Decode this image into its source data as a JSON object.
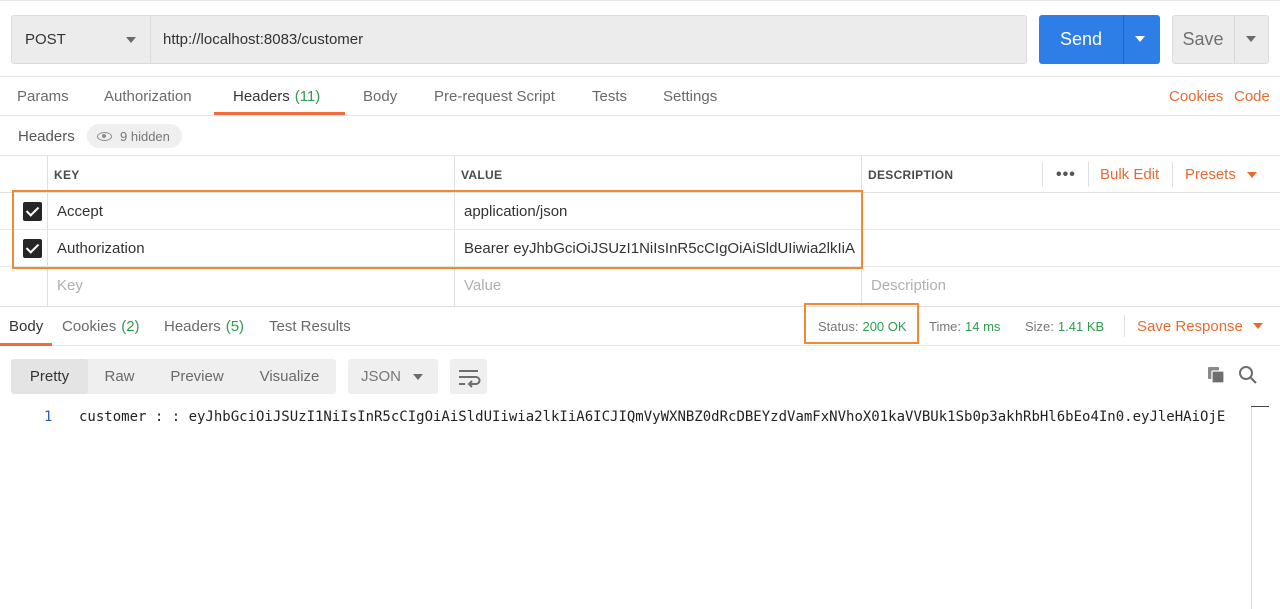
{
  "request": {
    "method": "POST",
    "url": "http://localhost:8083/customer",
    "send_label": "Send",
    "save_label": "Save"
  },
  "request_tabs": [
    {
      "label": "Params"
    },
    {
      "label": "Authorization"
    },
    {
      "label": "Headers",
      "count": "(11)",
      "active": true
    },
    {
      "label": "Body"
    },
    {
      "label": "Pre-request Script"
    },
    {
      "label": "Tests"
    },
    {
      "label": "Settings"
    }
  ],
  "request_links": {
    "cookies": "Cookies",
    "code": "Code"
  },
  "headers_section": {
    "title": "Headers",
    "hidden": "9 hidden"
  },
  "headers_table": {
    "columns": {
      "key": "KEY",
      "value": "VALUE",
      "description": "DESCRIPTION"
    },
    "more": "•••",
    "bulk_edit": "Bulk Edit",
    "presets": "Presets",
    "rows": [
      {
        "checked": true,
        "key": "Accept",
        "value": "application/json",
        "description": ""
      },
      {
        "checked": true,
        "key": "Authorization",
        "value": "Bearer eyJhbGciOiJSUzI1NiIsInR5cCIgOiAiSldUIiwia2lkIiA ...",
        "description": ""
      }
    ],
    "new_row": {
      "key_placeholder": "Key",
      "value_placeholder": "Value",
      "description_placeholder": "Description"
    }
  },
  "response": {
    "tabs": [
      {
        "label": "Body",
        "active": true
      },
      {
        "label": "Cookies",
        "count": "(2)"
      },
      {
        "label": "Headers",
        "count": "(5)"
      },
      {
        "label": "Test Results"
      }
    ],
    "status_label": "Status:",
    "status_value": "200 OK",
    "time_label": "Time:",
    "time_value": "14 ms",
    "size_label": "Size:",
    "size_value": "1.41 KB",
    "save_response": "Save Response",
    "views": [
      "Pretty",
      "Raw",
      "Preview",
      "Visualize"
    ],
    "active_view": "Pretty",
    "format": "JSON",
    "body_lines": [
      {
        "num": "1",
        "text": "customer : : eyJhbGciOiJSUzI1NiIsInR5cCIgOiAiSldUIiwia2lkIiA6ICJIQmVyWXNBZ0dRcDBEYzdVamFxNVhoX01kaVVBUk1Sb0p3akhRbHl6bEo4In0.eyJleHAiOjE"
      }
    ]
  },
  "icons": {
    "method_caret": "chevron-down-icon",
    "eye": "eye-icon",
    "wrap": "wrap-icon",
    "copy": "copy-icon",
    "search": "search-icon"
  },
  "colors": {
    "primary": "#2d7ee6",
    "accent": "#f26b3a",
    "success": "#2e9c4f",
    "highlight": "#f08a33"
  }
}
